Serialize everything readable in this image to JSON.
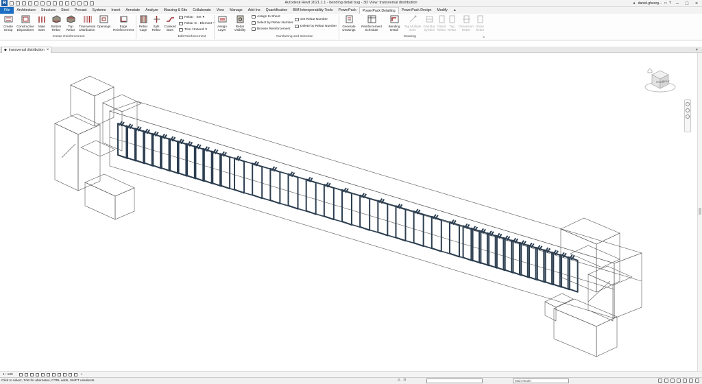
{
  "window": {
    "title": "Autodesk Revit 2021.1.1 - bending detail bug - 3D View: transversal distribution",
    "user": "daniel.gheorg...",
    "help_icon": "help-icon"
  },
  "tabs": [
    "File",
    "Architecture",
    "Structure",
    "Steel",
    "Precast",
    "Systems",
    "Insert",
    "Annotate",
    "Analyze",
    "Massing & Site",
    "Collaborate",
    "View",
    "Manage",
    "Add-Ins",
    "Quantification",
    "BIM Interoperability Tools",
    "PowerPack",
    "PowerPack Detailing",
    "PowerPack Design",
    "Modify"
  ],
  "active_tab": "PowerPack Detailing",
  "ribbon": {
    "create_reinforcement": {
      "label": "Create Reinforcement",
      "buttons": [
        {
          "label1": "Create",
          "label2": "Group"
        },
        {
          "label1": "Constructive",
          "label2": "Dispositions"
        },
        {
          "label1": "Male",
          "label2": "Bars"
        },
        {
          "label1": "Bottom",
          "label2": "Rebar"
        },
        {
          "label1": "Top",
          "label2": "Rebar"
        },
        {
          "label1": "Transversal",
          "label2": "Distribution"
        },
        {
          "label1": "Openings",
          "label2": ""
        },
        {
          "label1": "Edge",
          "label2": "Reinforcement"
        }
      ]
    },
    "edit_reinforcement": {
      "label": "Edit Reinforcement",
      "buttons": [
        {
          "label1": "Rebar",
          "label2": "Cage"
        },
        {
          "label1": "Split",
          "label2": "Rebar"
        },
        {
          "label1": "Cranked",
          "label2": "Bars"
        }
      ],
      "small": [
        "Rebar · Set",
        "Rebar In · Element",
        "Trim / Extend"
      ]
    },
    "numbering": {
      "label": "Numbering and Selection",
      "buttons": [
        {
          "label1": "Assign",
          "label2": "Layer"
        },
        {
          "label1": "Rebar",
          "label2": "Visibility"
        }
      ],
      "small": [
        "Assign to Sheet",
        "Select by Rebar Number",
        "Browse Reinforcement",
        "Set Rebar Number",
        "Delete by Rebar Number"
      ]
    },
    "drawing": {
      "label": "Drawing",
      "buttons": [
        {
          "label1": "Generate",
          "label2": "Drawings"
        },
        {
          "label1": "Reinforcement",
          "label2": "Schedule"
        },
        {
          "label1": "Bending",
          "label2": "Detail"
        },
        {
          "label1": "Tag Multiple",
          "label2": "Bars"
        },
        {
          "label1": "Grid Bar",
          "label2": "Symbol"
        },
        {
          "label1": "Detail",
          "label2": "Rebar"
        },
        {
          "label1": "Tag",
          "label2": "Rebar"
        },
        {
          "label1": "Dimension",
          "label2": "Rebar"
        },
        {
          "label1": "Show",
          "label2": "Rebar"
        }
      ]
    }
  },
  "view_tab": {
    "label": "transversal distribution",
    "close": "×"
  },
  "viewcube": {
    "face_front": "FRONT",
    "face_right": "RIGHT"
  },
  "view_controls": {
    "scale": "1 : 100"
  },
  "status": {
    "text": "Click to select, TAB for alternates, CTRL adds, SHIFT unselects.",
    "filter": ":0",
    "workset": "Main Model"
  },
  "colors": {
    "accent": "#1b6ec2",
    "rebar": "#2c3e50",
    "line": "#333333"
  }
}
